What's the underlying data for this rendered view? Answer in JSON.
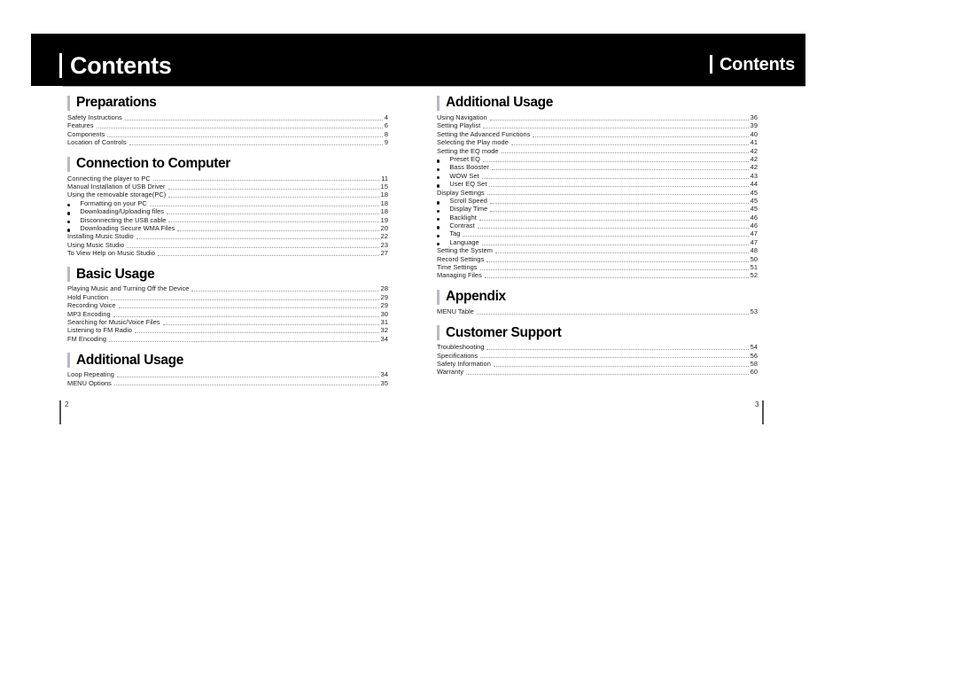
{
  "header": {
    "title_left": "Contents",
    "title_right": "Contents",
    "band_color": "#000000"
  },
  "footer": {
    "page_left": "2",
    "page_right": "3"
  },
  "left_column": [
    {
      "heading": "Preparations",
      "entries": [
        {
          "label": "Safety Instructions",
          "page": "4",
          "sub": false
        },
        {
          "label": "Features",
          "page": "6",
          "sub": false
        },
        {
          "label": "Components",
          "page": "8",
          "sub": false
        },
        {
          "label": "Location of Controls",
          "page": "9",
          "sub": false
        }
      ]
    },
    {
      "heading": "Connection to Computer",
      "entries": [
        {
          "label": "Connecting the player to PC",
          "page": "11",
          "sub": false
        },
        {
          "label": "Manual Installation of USB Driver",
          "page": "15",
          "sub": false
        },
        {
          "label": "Using the removable storage(PC)",
          "page": "18",
          "sub": false
        },
        {
          "label": "Formatting on your PC",
          "page": "18",
          "sub": true
        },
        {
          "label": "Downloading/Uploading files",
          "page": "18",
          "sub": true
        },
        {
          "label": "Disconnecting the USB cable",
          "page": "19",
          "sub": true
        },
        {
          "label": "Downloading Secure WMA Files",
          "page": "20",
          "sub": true
        },
        {
          "label": "Installing Music Studio",
          "page": "22",
          "sub": false
        },
        {
          "label": "Using Music Studio",
          "page": "23",
          "sub": false
        },
        {
          "label": "To View Help on Music Studio",
          "page": "27",
          "sub": false
        }
      ]
    },
    {
      "heading": "Basic Usage",
      "entries": [
        {
          "label": "Playing Music and Turning Off the Device",
          "page": "28",
          "sub": false
        },
        {
          "label": "Hold Function",
          "page": "29",
          "sub": false
        },
        {
          "label": "Recording Voice",
          "page": "29",
          "sub": false
        },
        {
          "label": "MP3 Encoding",
          "page": "30",
          "sub": false
        },
        {
          "label": "Searching for Music/Voice Files",
          "page": "31",
          "sub": false
        },
        {
          "label": "Listening to FM Radio",
          "page": "32",
          "sub": false
        },
        {
          "label": "FM Encoding",
          "page": "34",
          "sub": false
        }
      ]
    },
    {
      "heading": "Additional Usage",
      "entries": [
        {
          "label": "Loop Repeating",
          "page": "34",
          "sub": false
        },
        {
          "label": "MENU Options",
          "page": "35",
          "sub": false
        }
      ]
    }
  ],
  "right_column": [
    {
      "heading": "Additional Usage",
      "entries": [
        {
          "label": "Using Navigation",
          "page": "36",
          "sub": false
        },
        {
          "label": "Setting Playlist",
          "page": "39",
          "sub": false
        },
        {
          "label": "Setting the Advanced Functions",
          "page": "40",
          "sub": false
        },
        {
          "label": "Selecting the Play mode",
          "page": "41",
          "sub": false
        },
        {
          "label": "Setting the EQ mode",
          "page": "42",
          "sub": false
        },
        {
          "label": "Preset EQ",
          "page": "42",
          "sub": true
        },
        {
          "label": "Bass Booster",
          "page": "42",
          "sub": true
        },
        {
          "label": "WOW Set",
          "page": "43",
          "sub": true
        },
        {
          "label": "User EQ Set",
          "page": "44",
          "sub": true
        },
        {
          "label": "Display Settings",
          "page": "45",
          "sub": false
        },
        {
          "label": "Scroll Speed",
          "page": "45",
          "sub": true
        },
        {
          "label": "Display Time",
          "page": "45",
          "sub": true
        },
        {
          "label": "Backlight",
          "page": "46",
          "sub": true
        },
        {
          "label": "Contrast",
          "page": "46",
          "sub": true
        },
        {
          "label": "Tag",
          "page": "47",
          "sub": true
        },
        {
          "label": "Language",
          "page": "47",
          "sub": true
        },
        {
          "label": "Setting the System",
          "page": "48",
          "sub": false
        },
        {
          "label": "Record Settings",
          "page": "50",
          "sub": false
        },
        {
          "label": "Time Settings",
          "page": "51",
          "sub": false
        },
        {
          "label": "Managing Files",
          "page": "52",
          "sub": false
        }
      ]
    },
    {
      "heading": "Appendix",
      "entries": [
        {
          "label": "MENU Table",
          "page": "53",
          "sub": false
        }
      ]
    },
    {
      "heading": "Customer Support",
      "entries": [
        {
          "label": "Troubleshooting",
          "page": "54",
          "sub": false
        },
        {
          "label": "Specifications",
          "page": "56",
          "sub": false
        },
        {
          "label": "Safety Information",
          "page": "58",
          "sub": false
        },
        {
          "label": "Warranty",
          "page": "60",
          "sub": false
        }
      ]
    }
  ]
}
